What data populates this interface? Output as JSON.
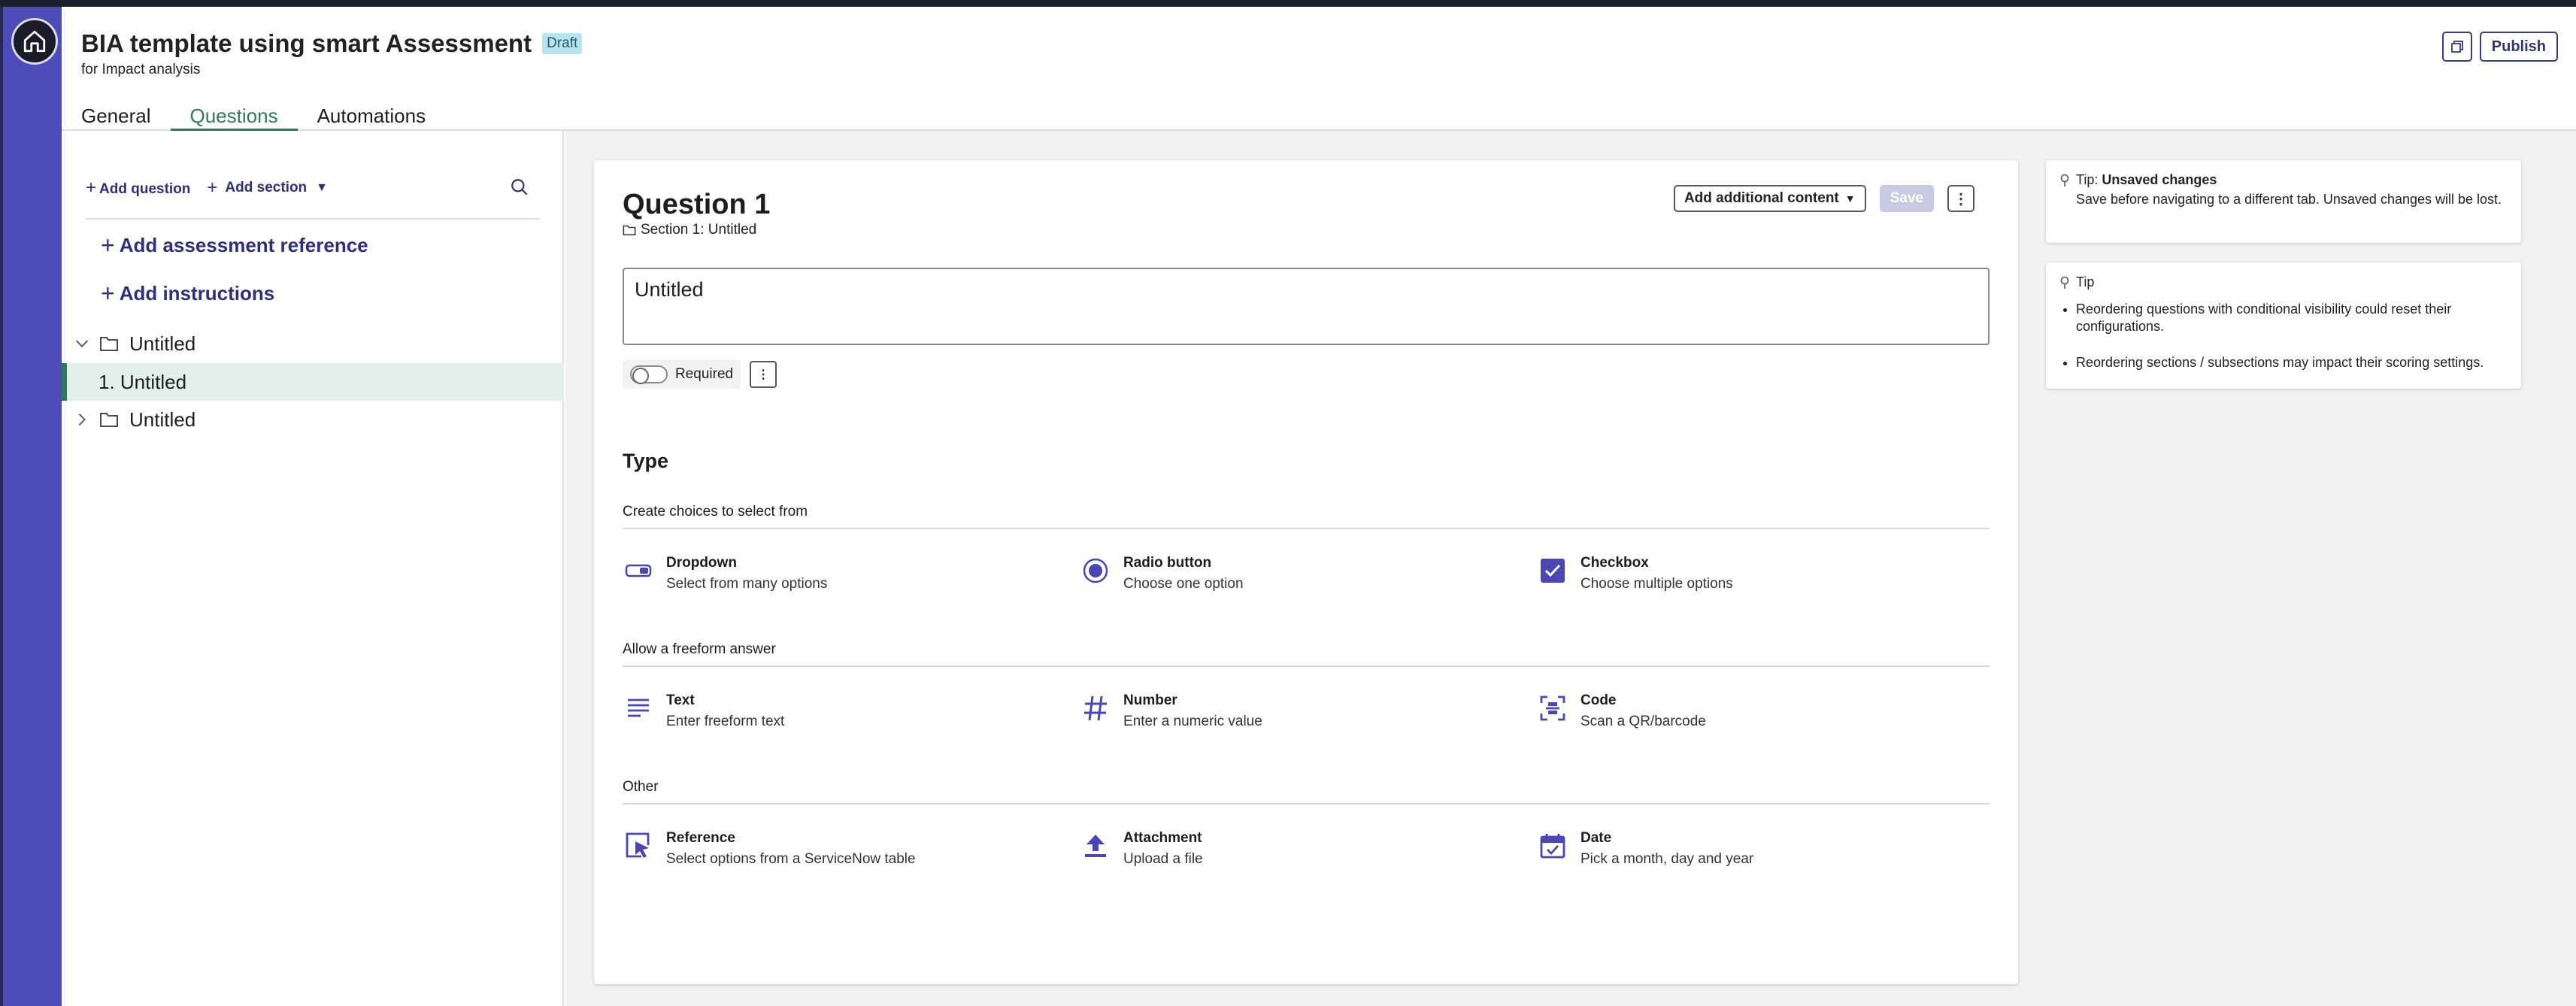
{
  "header": {
    "title": "BIA template using smart Assessment",
    "status_badge": "Draft",
    "subtitle": "for Impact analysis",
    "publish_label": "Publish",
    "tabs": [
      {
        "label": "General"
      },
      {
        "label": "Questions"
      },
      {
        "label": "Automations"
      }
    ],
    "active_tab": "Questions"
  },
  "left_panel": {
    "add_question": "Add question",
    "add_section": "Add section",
    "add_assessment_reference": "Add assessment reference",
    "add_instructions": "Add instructions",
    "tree": [
      {
        "label": "Untitled",
        "expanded": true
      },
      {
        "label": "1. Untitled",
        "selected": true
      },
      {
        "label": "Untitled",
        "expanded": false
      }
    ]
  },
  "question": {
    "title": "Question 1",
    "section": "Section 1: Untitled",
    "add_content_label": "Add additional content",
    "save_label": "Save",
    "text_value": "Untitled",
    "required_label": "Required",
    "required_on": false
  },
  "types": {
    "heading": "Type",
    "groups": [
      {
        "label": "Create choices to select from",
        "items": [
          {
            "title": "Dropdown",
            "desc": "Select from many options",
            "icon": "dropdown-icon"
          },
          {
            "title": "Radio button",
            "desc": "Choose one option",
            "icon": "radio-icon"
          },
          {
            "title": "Checkbox",
            "desc": "Choose multiple options",
            "icon": "checkbox-icon"
          }
        ]
      },
      {
        "label": "Allow a freeform answer",
        "items": [
          {
            "title": "Text",
            "desc": "Enter freeform text",
            "icon": "text-lines-icon"
          },
          {
            "title": "Number",
            "desc": "Enter a numeric value",
            "icon": "hash-icon"
          },
          {
            "title": "Code",
            "desc": "Scan a QR/barcode",
            "icon": "barcode-scan-icon"
          }
        ]
      },
      {
        "label": "Other",
        "items": [
          {
            "title": "Reference",
            "desc": "Select options from a ServiceNow table",
            "icon": "reference-icon"
          },
          {
            "title": "Attachment",
            "desc": "Upload a file",
            "icon": "upload-icon"
          },
          {
            "title": "Date",
            "desc": "Pick a month, day and year",
            "icon": "calendar-icon"
          }
        ]
      }
    ]
  },
  "tips": {
    "unsaved_prefix": "Tip: ",
    "unsaved_title": "Unsaved changes",
    "unsaved_text": "Save before navigating to a different tab. Unsaved changes will be lost.",
    "tip_label": "Tip",
    "tip_items": [
      "Reordering questions with conditional visibility could reset their configurations.",
      "Reordering sections / subsections may impact their scoring settings."
    ]
  },
  "colors": {
    "accent": "#2f7a5b",
    "brand": "#4d4bb8",
    "icon": "#4a47b5"
  }
}
